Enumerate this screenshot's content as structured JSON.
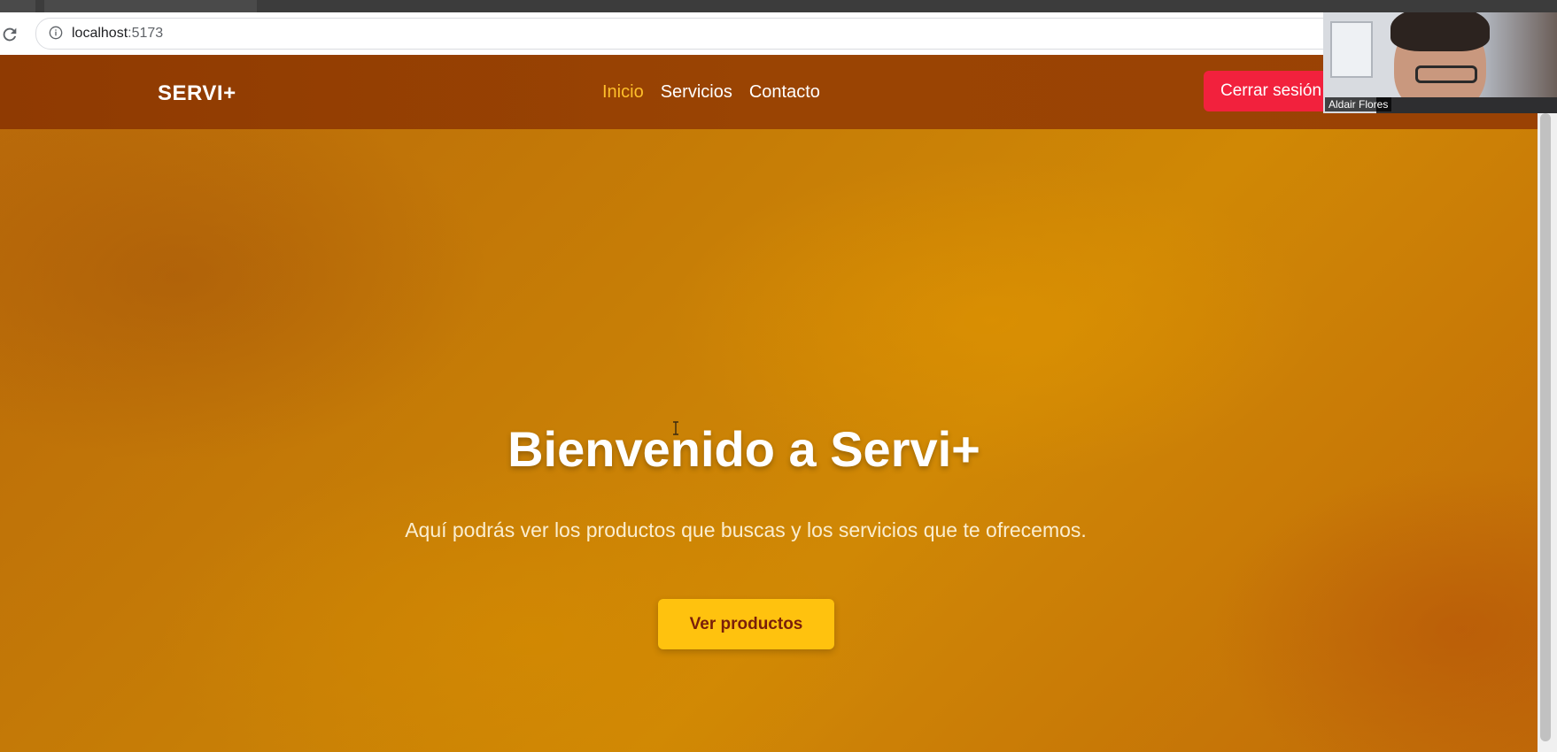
{
  "browser": {
    "url_host": "localhost",
    "url_port": ":5173",
    "reload_icon": "reload-icon",
    "info_icon": "info-icon"
  },
  "navbar": {
    "brand": "SERVI+",
    "links": [
      {
        "label": "Inicio",
        "active": true
      },
      {
        "label": "Servicios",
        "active": false
      },
      {
        "label": "Contacto",
        "active": false
      }
    ],
    "logout_label": "Cerrar sesión"
  },
  "hero": {
    "title": "Bienvenido a Servi+",
    "subtitle": "Aquí podrás ver los productos que buscas y los servicios que te ofrecemos.",
    "cta_label": "Ver productos"
  },
  "webcam": {
    "name": "Aldair Flores"
  },
  "colors": {
    "navbar": "#9a4403",
    "active_link": "#ffbf2a",
    "logout_button": "#f2213d",
    "cta_button": "#ffc20e",
    "cta_text": "#7a1f0a"
  }
}
